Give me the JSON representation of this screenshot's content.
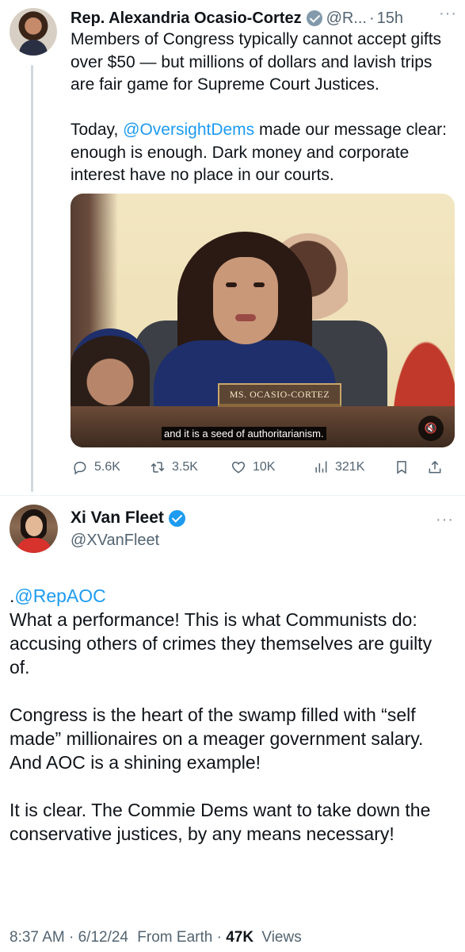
{
  "parent_tweet": {
    "author_name": "Rep. Alexandria Ocasio-Cortez",
    "handle": "@R...",
    "separator": "·",
    "time": "15h",
    "more": "···",
    "paragraph1": "Members of Congress typically cannot accept gifts over $50 — but millions of dollars and lavish trips are fair game for Supreme Court Justices.",
    "paragraph2_prefix": "Today, ",
    "paragraph2_mention": "@OversightDems",
    "paragraph2_suffix": " made our message clear: enough is enough. Dark money and corporate interest have no place in our courts.",
    "video": {
      "nameplate": "MS. OCASIO-CORTEZ",
      "caption": "and it is a seed of authoritarianism.",
      "mute_icon": "speaker-muted-icon"
    },
    "actions": {
      "replies": "5.6K",
      "reposts": "3.5K",
      "likes": "10K",
      "views": "321K"
    }
  },
  "main_tweet": {
    "author_name": "Xi Van Fleet",
    "handle": "@XVanFleet",
    "more": "···",
    "mention_line_prefix": ".",
    "mention": "@RepAOC",
    "paragraph1": "What a performance! This is what Communists do: accusing others of crimes they themselves are guilty of.",
    "paragraph2": "Congress is the heart of the swamp filled with “self made” millionaires on a meager government salary. And AOC is a shining example!",
    "paragraph3": "It is clear. The Commie Dems want to take down the conservative justices, by any means necessary!",
    "meta": {
      "time": "8:37 AM",
      "date": "6/12/24",
      "source": "From Earth",
      "views_count": "47K",
      "views_label": "Views"
    }
  },
  "colors": {
    "link": "#1d9bf0",
    "secondary_text": "#536471",
    "primary_text": "#0f1419",
    "verified_grey": "#829aab",
    "verified_blue": "#1d9bf0"
  }
}
